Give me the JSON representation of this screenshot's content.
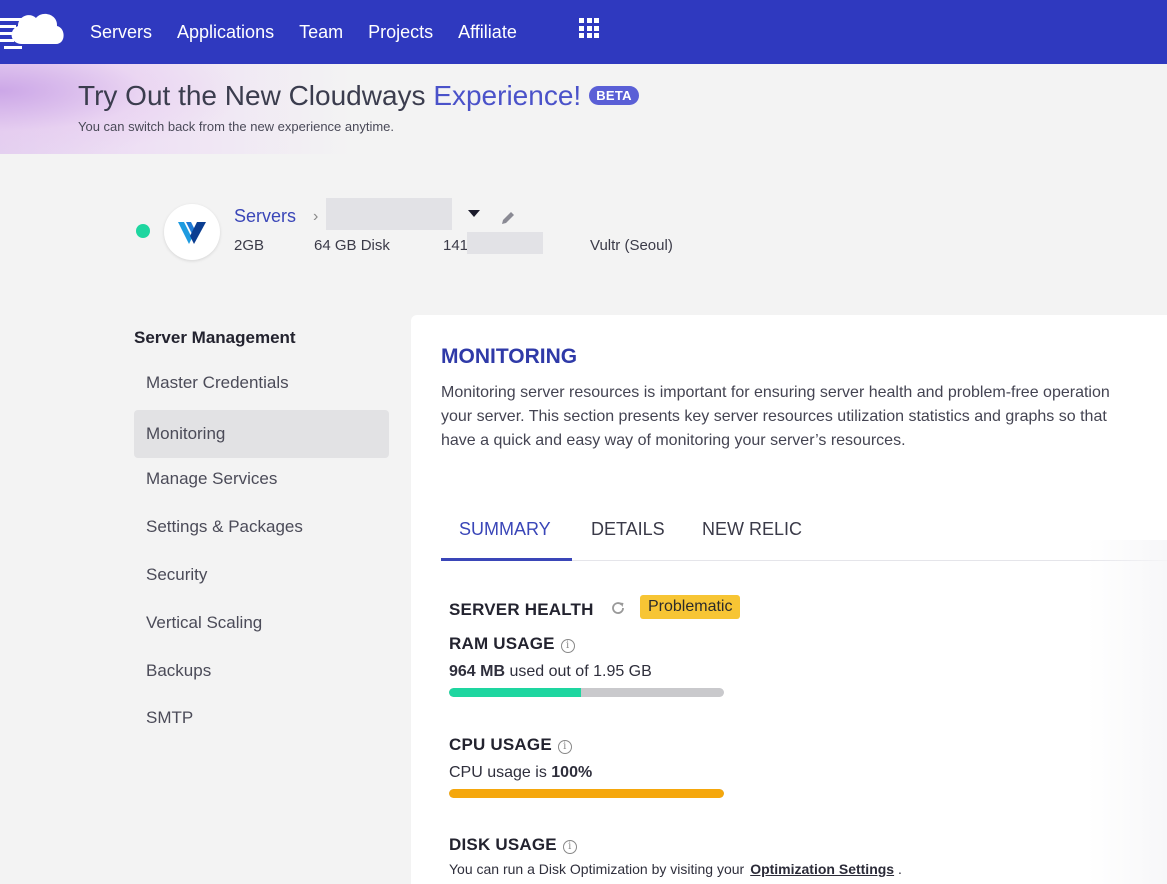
{
  "nav": {
    "items": [
      "Servers",
      "Applications",
      "Team",
      "Projects",
      "Affiliate"
    ],
    "brand_color": "#2f39bf"
  },
  "banner": {
    "title_prefix": "Try Out the New Cloudways ",
    "title_accent": "Experience!",
    "beta": "BETA",
    "subtitle": "You can switch back from the new experience anytime."
  },
  "server": {
    "breadcrumb_root": "Servers",
    "status": "running",
    "status_color": "#1ed6a0",
    "ram": "2GB",
    "disk": "64 GB Disk",
    "ip_prefix": "141.",
    "provider_location": "Vultr (Seoul)"
  },
  "sidebar": {
    "title": "Server Management",
    "items": [
      "Master Credentials",
      "Monitoring",
      "Manage Services",
      "Settings & Packages",
      "Security",
      "Vertical Scaling",
      "Backups",
      "SMTP"
    ],
    "active": "Monitoring"
  },
  "main": {
    "title": "MONITORING",
    "description": [
      "Monitoring server resources is important for ensuring server health and problem-free operation",
      "your server. This section presents key server resources utilization statistics and graphs so that",
      "have a quick and easy way of monitoring your server’s resources."
    ],
    "tabs": [
      "SUMMARY",
      "DETAILS",
      "NEW RELIC"
    ],
    "active_tab": "SUMMARY",
    "health": {
      "title": "SERVER HEALTH",
      "status": "Problematic",
      "status_color": "#f7c534"
    },
    "ram": {
      "title": "RAM USAGE",
      "used": "964 MB",
      "text_mid": " used out of ",
      "total": "1.95 GB",
      "fraction": 0.48,
      "bar_color": "#1ed6a0"
    },
    "cpu": {
      "title": "CPU USAGE",
      "text_prefix": "CPU usage is ",
      "value": "100%",
      "fraction": 1.0,
      "bar_color": "#f5a70c"
    },
    "disk": {
      "title": "DISK USAGE",
      "text": "You can run a Disk Optimization by visiting your",
      "link": "Optimization Settings",
      "suffix": " ."
    }
  }
}
